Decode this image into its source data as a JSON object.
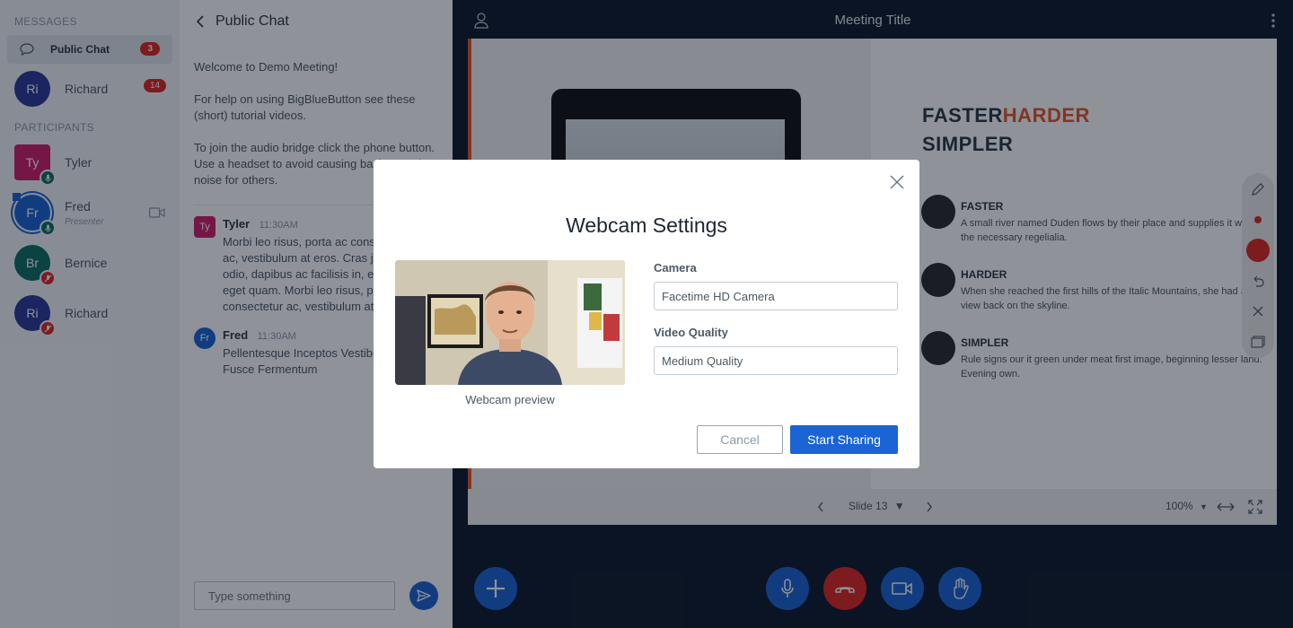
{
  "userlist": {
    "messages_title": "MESSAGES",
    "public_chat": {
      "label": "Public Chat",
      "badge": "3"
    },
    "private_chat": {
      "initials": "Ri",
      "name": "Richard",
      "badge": "14"
    },
    "participants_title": "PARTICIPANTS",
    "participants": [
      {
        "initials": "Ty",
        "name": "Tyler",
        "sub": "",
        "color": "#d0206a"
      },
      {
        "initials": "Fr",
        "name": "Fred",
        "sub": "Presenter",
        "color": "#1b64d4"
      },
      {
        "initials": "Br",
        "name": "Bernice",
        "sub": "",
        "color": "#0f7063"
      },
      {
        "initials": "Ri",
        "name": "Richard",
        "sub": "",
        "color": "#2d3a9a"
      }
    ]
  },
  "chat": {
    "title": "Public Chat",
    "welcome": [
      "Welcome to Demo Meeting!",
      "For help on using BigBlueButton see these (short) tutorial videos.",
      "To join the audio bridge click the phone button. Use a headset to avoid causing background noise for others."
    ],
    "messages": [
      {
        "initials": "Ty",
        "name": "Tyler",
        "time": "11:30AM",
        "text": "Morbi leo risus, porta ac consectetur\nac, vestibulum at eros. Cras justo\nodio, dapibus ac facilisis in, egestas\neget quam. Morbi leo risus, porta ac\nconsectetur ac, vestibulum at eros."
      },
      {
        "initials": "Fr",
        "name": "Fred",
        "time": "11:30AM",
        "text": "Pellentesque Inceptos Vestibulum\nFusce Fermentum"
      }
    ],
    "input_placeholder": "Type something"
  },
  "main": {
    "title": "Meeting Title",
    "slide": {
      "heading_part1": "FASTER",
      "heading_part2": "HARDER",
      "heading_line2": "SIMPLER",
      "features": [
        {
          "title": "FASTER",
          "desc": "A small river named Duden flows by their place and supplies it with the necessary regelialia."
        },
        {
          "title": "HARDER",
          "desc": "When she reached the first hills of the Italic Mountains, she had a last view back on the skyline."
        },
        {
          "title": "SIMPLER",
          "desc": "Rule signs our it green under meat first image, beginning lesser land. Evening own."
        }
      ]
    },
    "slide_bar": {
      "slide_label": "Slide 13",
      "zoom": "100%"
    }
  },
  "modal": {
    "title": "Webcam Settings",
    "preview_caption": "Webcam preview",
    "camera_label": "Camera",
    "camera_value": "Facetime HD Camera",
    "quality_label": "Video Quality",
    "quality_value": "Medium Quality",
    "cancel_label": "Cancel",
    "start_label": "Start Sharing"
  },
  "colors": {
    "accent": "#1b64d4",
    "danger": "#df2721",
    "slide_accent": "#e8562a",
    "main_bg": "#0e1b2c"
  }
}
